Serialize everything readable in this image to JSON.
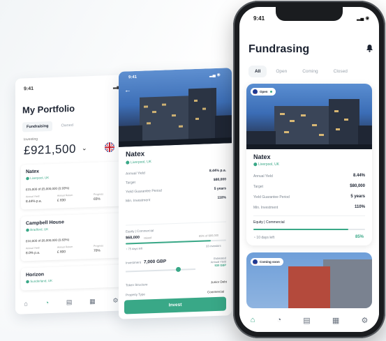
{
  "portfolio": {
    "status_time": "9:41",
    "status_icons": "▂▄ ◉",
    "title": "My Portfolio",
    "tabs": [
      "Fundraising",
      "Owned"
    ],
    "investing_label": "Investing",
    "amount": "£921,500",
    "cards": [
      {
        "name": "Natex",
        "location": "Liverpool, UK",
        "raised": "£15,000 of £5,000,000 (0.93%)",
        "stats_labels": [
          "Annual Yield",
          "Annual Return",
          "Progress"
        ],
        "stats_values": [
          "8.44% p.a.",
          "£ 830",
          "65%"
        ]
      },
      {
        "name": "Campbell House",
        "location": "Bradford, UK",
        "raised": "£10,000 of £6,000,000 (0.83%)",
        "stats_labels": [
          "Annual Yield",
          "Annual Return",
          "Progress"
        ],
        "stats_values": [
          "8.0% p.a.",
          "£ 800",
          "70%"
        ]
      },
      {
        "name": "Horizon",
        "location": "Sunderland, UK"
      }
    ],
    "nav": [
      "⌂",
      "◔",
      "▤",
      "▦",
      "⚙"
    ]
  },
  "detail": {
    "status_time": "9:41",
    "status_icons": "▂▄ ◉",
    "back": "←",
    "name": "Natex",
    "location": "Liverpool, UK",
    "rows": [
      {
        "label": "Annual Yield",
        "value": "8.44% p.a."
      },
      {
        "label": "Target",
        "value": "$80,000"
      },
      {
        "label": "Yield Guarantee Period",
        "value": "5 years"
      },
      {
        "label": "Min. Investment",
        "value": "110%"
      }
    ],
    "equity_label": "Equity | Commercial",
    "raised": "$68,000",
    "raised_sub": "raised",
    "raised_right": "85% of $80,000",
    "progress": 0.85,
    "meta_left": "75 days left",
    "meta_right": "33 investors",
    "investment_label": "Investment",
    "investment_value": "7,000 GBP",
    "estimated_label": "Estimated Annual Yield",
    "estimated_value": "530 GBP",
    "slider_fraction": 0.75,
    "token_label": "Token Structure",
    "token_value": "Junior Debt",
    "property_label": "Property Type",
    "property_value": "Commercial",
    "invest_button": "Invest"
  },
  "phone": {
    "status_time": "9:41",
    "status_icons": "▂▄ ◉",
    "title": "Fundrasing",
    "bell": "🔔",
    "tabs": [
      "All",
      "Open",
      "Coming",
      "Closed"
    ],
    "card": {
      "pill": "Open",
      "name": "Natex",
      "location": "Liverpool, UK",
      "rows": [
        {
          "label": "Annual Yield",
          "value": "8.44%"
        },
        {
          "label": "Target",
          "value": "$80,000"
        },
        {
          "label": "Yield Guarantee Period",
          "value": "5 years"
        },
        {
          "label": "Min. Investment",
          "value": "110%"
        }
      ],
      "equity_label": "Equity | Commercial",
      "days_left": "10 days left",
      "percent": "85%",
      "progress": 0.85
    },
    "card2_pill": "Coming soon",
    "nav": [
      "⌂",
      "◔",
      "▤",
      "▦",
      "⚙"
    ]
  },
  "colors": {
    "accent": "#39a887",
    "text": "#1c2331",
    "muted": "#7b8590"
  }
}
